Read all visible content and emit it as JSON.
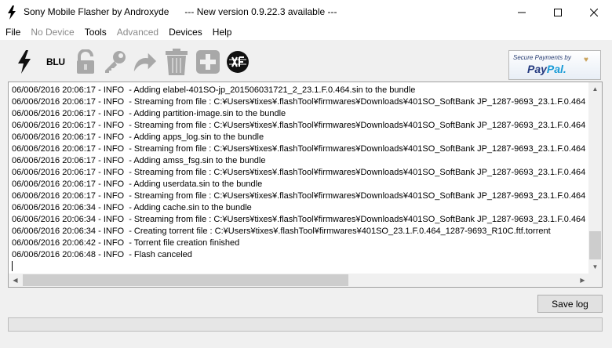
{
  "window": {
    "title": "Sony Mobile Flasher by Androxyde      --- New version 0.9.22.3 available ---"
  },
  "menu": {
    "items": [
      {
        "label": "File",
        "enabled": true
      },
      {
        "label": "No Device",
        "enabled": false
      },
      {
        "label": "Tools",
        "enabled": true
      },
      {
        "label": "Advanced",
        "enabled": false
      },
      {
        "label": "Devices",
        "enabled": true
      },
      {
        "label": "Help",
        "enabled": true
      }
    ]
  },
  "toolbar": {
    "blu_label": "BLU",
    "icons": [
      "flash-icon",
      "blu-icon",
      "unlock-icon",
      "key-icon",
      "redo-arrow-icon",
      "trash-icon",
      "add-icon",
      "xperia-firmware-icon"
    ],
    "paypal": {
      "secure_text": "Secure Payments by",
      "logo_pay": "Pay",
      "logo_pal": "Pal."
    }
  },
  "log": {
    "lines": [
      "06/006/2016 20:06:17 - INFO  - Adding elabel-401SO-jp_201506031721_2_23.1.F.0.464.sin to the bundle",
      "06/006/2016 20:06:17 - INFO  - Streaming from file : C:¥Users¥tixes¥.flashTool¥firmwares¥Downloads¥401SO_SoftBank JP_1287-9693_23.1.F.0.464",
      "06/006/2016 20:06:17 - INFO  - Adding partition-image.sin to the bundle",
      "06/006/2016 20:06:17 - INFO  - Streaming from file : C:¥Users¥tixes¥.flashTool¥firmwares¥Downloads¥401SO_SoftBank JP_1287-9693_23.1.F.0.464",
      "06/006/2016 20:06:17 - INFO  - Adding apps_log.sin to the bundle",
      "06/006/2016 20:06:17 - INFO  - Streaming from file : C:¥Users¥tixes¥.flashTool¥firmwares¥Downloads¥401SO_SoftBank JP_1287-9693_23.1.F.0.464",
      "06/006/2016 20:06:17 - INFO  - Adding amss_fsg.sin to the bundle",
      "06/006/2016 20:06:17 - INFO  - Streaming from file : C:¥Users¥tixes¥.flashTool¥firmwares¥Downloads¥401SO_SoftBank JP_1287-9693_23.1.F.0.464",
      "06/006/2016 20:06:17 - INFO  - Adding userdata.sin to the bundle",
      "06/006/2016 20:06:17 - INFO  - Streaming from file : C:¥Users¥tixes¥.flashTool¥firmwares¥Downloads¥401SO_SoftBank JP_1287-9693_23.1.F.0.464",
      "06/006/2016 20:06:34 - INFO  - Adding cache.sin to the bundle",
      "06/006/2016 20:06:34 - INFO  - Streaming from file : C:¥Users¥tixes¥.flashTool¥firmwares¥Downloads¥401SO_SoftBank JP_1287-9693_23.1.F.0.464",
      "06/006/2016 20:06:34 - INFO  - Creating torrent file : C:¥Users¥tixes¥.flashTool¥firmwares¥401SO_23.1.F.0.464_1287-9693_R10C.ftf.torrent",
      "06/006/2016 20:06:42 - INFO  - Torrent file creation finished",
      "06/006/2016 20:06:48 - INFO  - Flash canceled"
    ]
  },
  "actions": {
    "save_log_label": "Save log"
  },
  "progress": {
    "value": 0
  },
  "colors": {
    "window_bg": "#f0f0f0",
    "disabled_text": "#8a8a8a",
    "paypal_blue_dark": "#253b80",
    "paypal_blue_light": "#179bd7"
  }
}
